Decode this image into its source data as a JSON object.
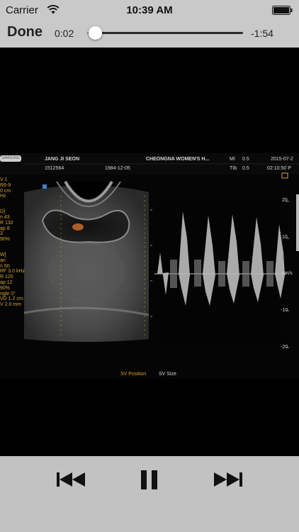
{
  "status_bar": {
    "carrier": "Carrier",
    "time": "10:39 AM"
  },
  "player": {
    "done_label": "Done",
    "elapsed": "0:02",
    "remaining": "-1:54",
    "progress_fraction": 0.05
  },
  "ultrasound": {
    "logo": "SAMSUNG",
    "patient_name": "JANG JI SEON",
    "patient_id": "1512564",
    "birth_date": "1984-12-05",
    "institution": "CHEONGNA WOMEN'S H...",
    "mi_label": "MI",
    "mi_value": "0.5",
    "tib_label": "TIb",
    "tib_value": "0.5",
    "date": "2015-07-2",
    "clock": "02:10:50 P",
    "left_panel": [
      "V 1",
      "R6-9",
      "0 cm",
      "Hz",
      "D]",
      "n 43",
      "R 132",
      "ap 8",
      "3",
      "90%",
      "W]",
      "an",
      "n 50",
      "RF 3.0 kHz",
      "R 120",
      "ap 12",
      "90%",
      "ngle 0°",
      "VD 1.2 cm",
      "V 2.0 mm"
    ],
    "doppler_scale": [
      "20",
      "10",
      "cm/s",
      "-10",
      "-20"
    ],
    "sv_position": "SV Position",
    "sv_size": "SV Size"
  },
  "icons": {
    "wifi": "wifi-icon",
    "battery": "battery-icon",
    "rewind": "skip-back-icon",
    "pause": "pause-icon",
    "forward": "skip-forward-icon"
  },
  "colors": {
    "chrome_top": "#c9c9c9",
    "chrome_bottom": "#c2c2c2",
    "video_bg": "#000000",
    "overlay_orange": "#d6a233"
  }
}
